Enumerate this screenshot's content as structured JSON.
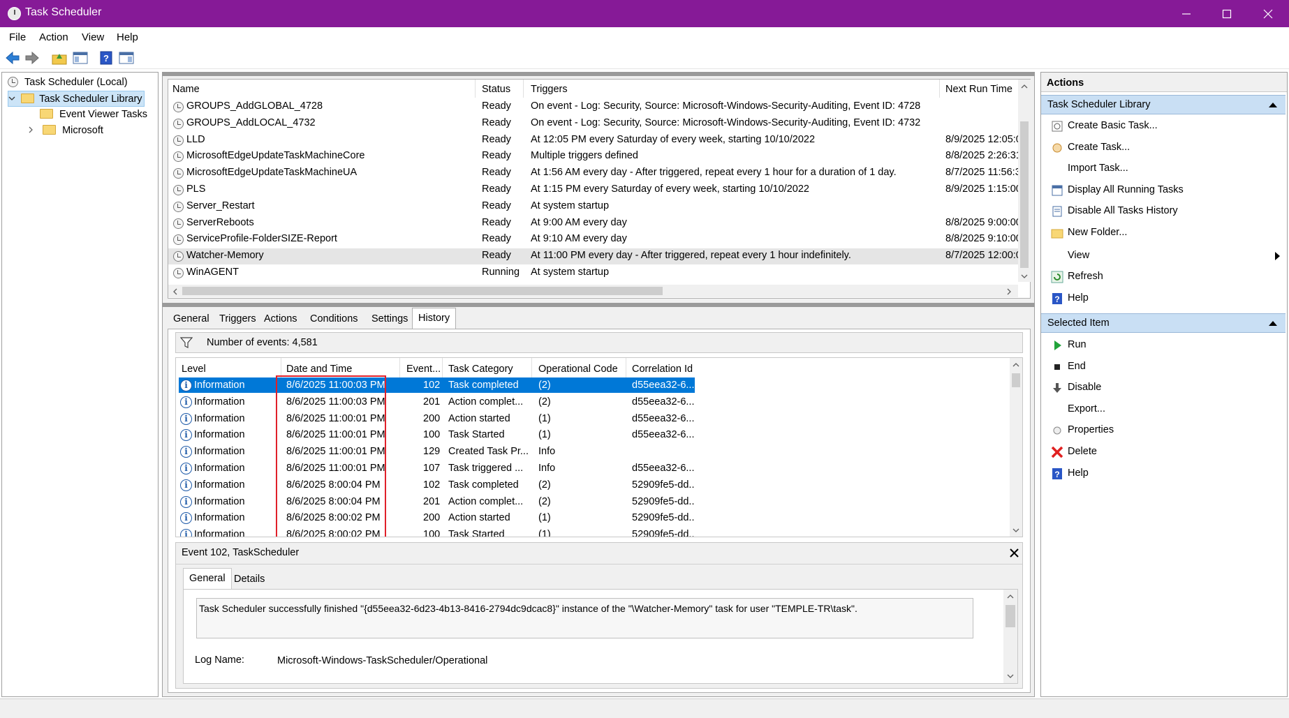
{
  "window": {
    "title": "Task Scheduler"
  },
  "menu": [
    "File",
    "Action",
    "View",
    "Help"
  ],
  "tree": {
    "root": "Task Scheduler (Local)",
    "library": "Task Scheduler Library",
    "children": [
      "Event Viewer Tasks",
      "Microsoft"
    ]
  },
  "tasks": {
    "columns": [
      "Name",
      "Status",
      "Triggers",
      "Next Run Time"
    ],
    "rows": [
      {
        "name": "GROUPS_AddGLOBAL_4728",
        "status": "Ready",
        "triggers": "On event - Log: Security, Source: Microsoft-Windows-Security-Auditing, Event ID: 4728",
        "next": ""
      },
      {
        "name": "GROUPS_AddLOCAL_4732",
        "status": "Ready",
        "triggers": "On event - Log: Security, Source: Microsoft-Windows-Security-Auditing, Event ID: 4732",
        "next": ""
      },
      {
        "name": "LLD",
        "status": "Ready",
        "triggers": "At 12:05 PM every Saturday of every week, starting 10/10/2022",
        "next": "8/9/2025 12:05:0"
      },
      {
        "name": "MicrosoftEdgeUpdateTaskMachineCore",
        "status": "Ready",
        "triggers": "Multiple triggers defined",
        "next": "8/8/2025 2:26:31"
      },
      {
        "name": "MicrosoftEdgeUpdateTaskMachineUA",
        "status": "Ready",
        "triggers": "At 1:56 AM every day - After triggered, repeat every 1 hour for a duration of 1 day.",
        "next": "8/7/2025 11:56:3"
      },
      {
        "name": "PLS",
        "status": "Ready",
        "triggers": "At 1:15 PM every Saturday of every week, starting 10/10/2022",
        "next": "8/9/2025 1:15:00"
      },
      {
        "name": "Server_Restart",
        "status": "Ready",
        "triggers": "At system startup",
        "next": ""
      },
      {
        "name": "ServerReboots",
        "status": "Ready",
        "triggers": "At 9:00 AM every day",
        "next": "8/8/2025 9:00:00"
      },
      {
        "name": "ServiceProfile-FolderSIZE-Report",
        "status": "Ready",
        "triggers": "At 9:10 AM every day",
        "next": "8/8/2025 9:10:00"
      },
      {
        "name": "Watcher-Memory",
        "status": "Ready",
        "triggers": "At 11:00 PM every day - After triggered, repeat every 1 hour indefinitely.",
        "next": "8/7/2025 12:00:0"
      },
      {
        "name": "WinAGENT",
        "status": "Running",
        "triggers": "At system startup",
        "next": ""
      }
    ]
  },
  "detail_tabs": [
    "General",
    "Triggers",
    "Actions",
    "Conditions",
    "Settings",
    "History"
  ],
  "history": {
    "count_label": "Number of events: 4,581",
    "columns": [
      "Level",
      "Date and Time",
      "Event...",
      "Task Category",
      "Operational Code",
      "Correlation Id"
    ],
    "rows": [
      {
        "level": "Information",
        "date": "8/6/2025 11:00:03 PM",
        "event": "102",
        "category": "Task completed",
        "op": "(2)",
        "corr": "d55eea32-6..."
      },
      {
        "level": "Information",
        "date": "8/6/2025 11:00:03 PM",
        "event": "201",
        "category": "Action complet...",
        "op": "(2)",
        "corr": "d55eea32-6..."
      },
      {
        "level": "Information",
        "date": "8/6/2025 11:00:01 PM",
        "event": "200",
        "category": "Action started",
        "op": "(1)",
        "corr": "d55eea32-6..."
      },
      {
        "level": "Information",
        "date": "8/6/2025 11:00:01 PM",
        "event": "100",
        "category": "Task Started",
        "op": "(1)",
        "corr": "d55eea32-6..."
      },
      {
        "level": "Information",
        "date": "8/6/2025 11:00:01 PM",
        "event": "129",
        "category": "Created Task Pr...",
        "op": "Info",
        "corr": ""
      },
      {
        "level": "Information",
        "date": "8/6/2025 11:00:01 PM",
        "event": "107",
        "category": "Task triggered ...",
        "op": "Info",
        "corr": "d55eea32-6..."
      },
      {
        "level": "Information",
        "date": "8/6/2025 8:00:04 PM",
        "event": "102",
        "category": "Task completed",
        "op": "(2)",
        "corr": "52909fe5-dd..."
      },
      {
        "level": "Information",
        "date": "8/6/2025 8:00:04 PM",
        "event": "201",
        "category": "Action complet...",
        "op": "(2)",
        "corr": "52909fe5-dd..."
      },
      {
        "level": "Information",
        "date": "8/6/2025 8:00:02 PM",
        "event": "200",
        "category": "Action started",
        "op": "(1)",
        "corr": "52909fe5-dd..."
      },
      {
        "level": "Information",
        "date": "8/6/2025 8:00:02 PM",
        "event": "100",
        "category": "Task Started",
        "op": "(1)",
        "corr": "52909fe5-dd..."
      }
    ]
  },
  "event_panel": {
    "title": "Event 102, TaskScheduler",
    "tabs": [
      "General",
      "Details"
    ],
    "message": "Task Scheduler successfully finished \"{d55eea32-6d23-4b13-8416-2794dc9dcac8}\" instance of the \"\\Watcher-Memory\" task for user \"TEMPLE-TR\\task\".",
    "log_name_label": "Log Name:",
    "log_name_value": "Microsoft-Windows-TaskScheduler/Operational"
  },
  "actions": {
    "header": "Actions",
    "section1": "Task Scheduler Library",
    "items1": [
      "Create Basic Task...",
      "Create Task...",
      "Import Task...",
      "Display All Running Tasks",
      "Disable All Tasks History",
      "New Folder...",
      "View",
      "Refresh",
      "Help"
    ],
    "section2": "Selected Item",
    "items2": [
      "Run",
      "End",
      "Disable",
      "Export...",
      "Properties",
      "Delete",
      "Help"
    ]
  },
  "colors": {
    "titlebar": "#861a97",
    "selection": "#0078d7",
    "highlight_box": "#e0202a",
    "section_header": "#c9dff4"
  }
}
